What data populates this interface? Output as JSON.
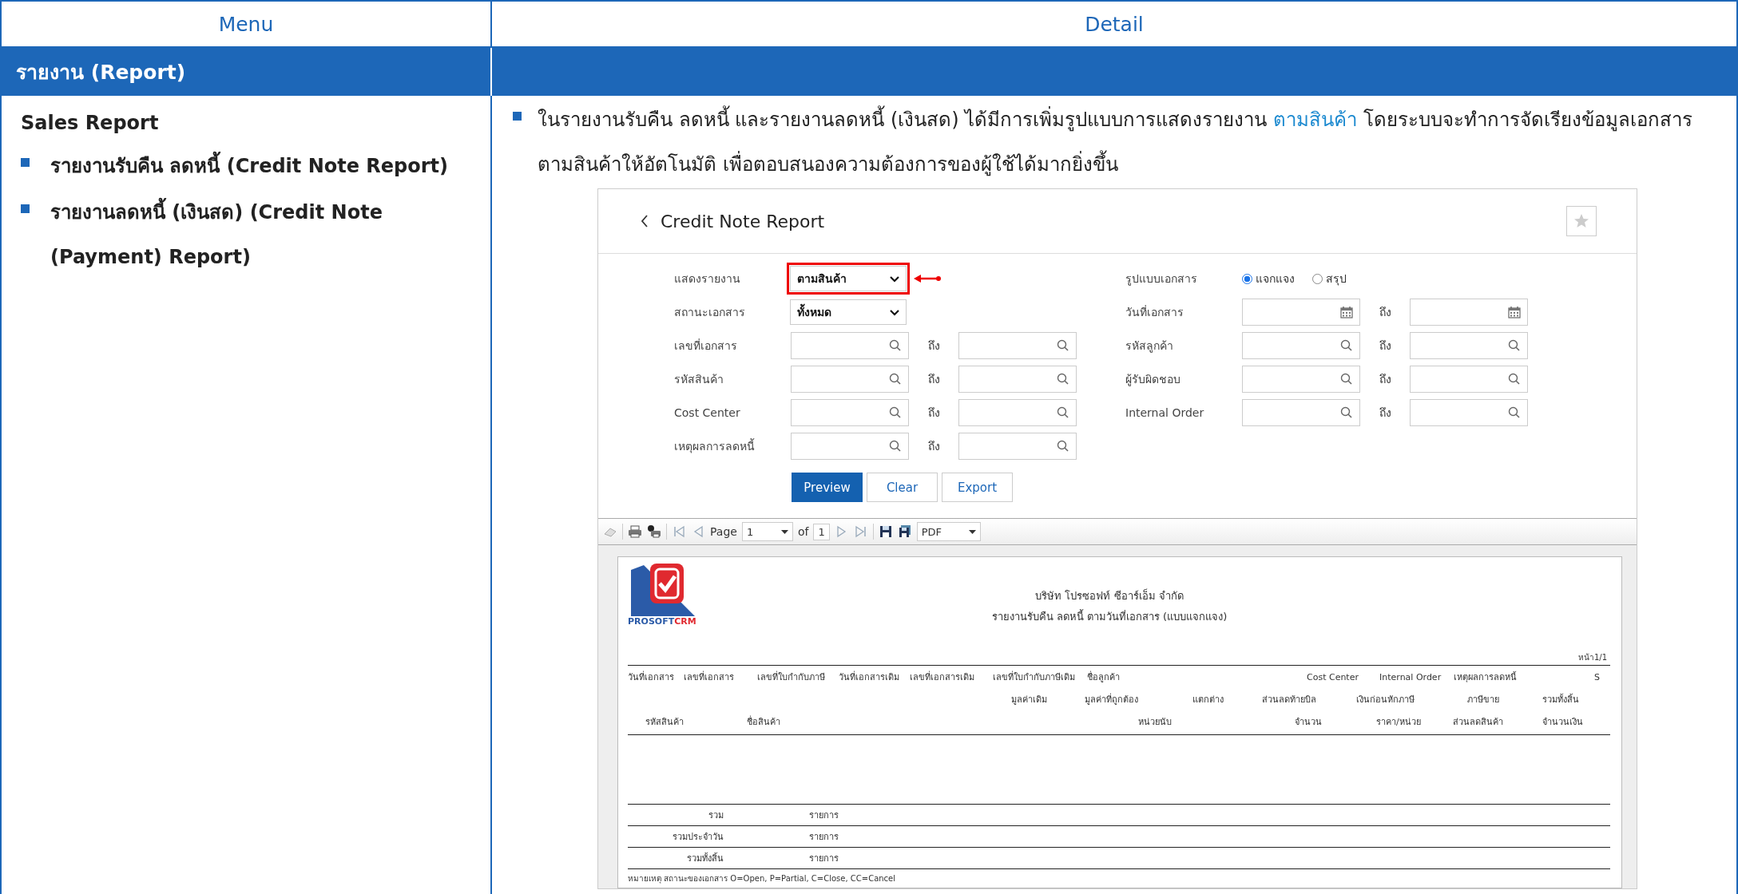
{
  "table": {
    "columns": [
      "Menu",
      "Detail"
    ],
    "section": "รายงาน (Report)"
  },
  "menu": {
    "title": "Sales Report",
    "items": [
      "รายงานรับคืน ลดหนี้ (Credit Note Report)",
      "รายงานลดหนี้ (เงินสด) (Credit Note (Payment) Report)"
    ]
  },
  "detail": {
    "text_before": "ในรายงานรับคืน ลดหนี้ และรายงานลดหนี้ (เงินสด) ได้มีการเพิ่มรูปแบบการแสดงรายงาน ",
    "highlight": "ตามสินค้า",
    "text_after": " โดยระบบจะทำการจัดเรียงข้อมูลเอกสารตามสินค้าให้อัตโนมัติ เพื่อตอบสนองความต้องการของผู้ใช้ได้มากยิ่งขึ้น"
  },
  "screenshot": {
    "title": "Credit Note Report",
    "form_left": [
      {
        "label": "แสดงรายงาน",
        "kind": "select",
        "value": "ตามสินค้า",
        "highlighted": true
      },
      {
        "label": "สถานะเอกสาร",
        "kind": "select",
        "value": "ทั้งหมด",
        "highlighted": false
      },
      {
        "label": "เลขที่เอกสาร",
        "kind": "range",
        "to": "ถึง"
      },
      {
        "label": "รหัสสินค้า",
        "kind": "range",
        "to": "ถึง"
      },
      {
        "label": "Cost Center",
        "kind": "range",
        "to": "ถึง"
      },
      {
        "label": "เหตุผลการลดหนี้",
        "kind": "range",
        "to": "ถึง"
      }
    ],
    "form_right": [
      {
        "label": "รูปแบบเอกสาร",
        "kind": "radio",
        "options": [
          {
            "label": "แจกแจง",
            "selected": true
          },
          {
            "label": "สรุป",
            "selected": false
          }
        ]
      },
      {
        "label": "วันที่เอกสาร",
        "kind": "date_range",
        "to": "ถึง"
      },
      {
        "label": "รหัสลูกค้า",
        "kind": "range",
        "to": "ถึง"
      },
      {
        "label": "ผู้รับผิดชอบ",
        "kind": "range",
        "to": "ถึง"
      },
      {
        "label": "Internal Order",
        "kind": "range",
        "to": "ถึง"
      }
    ],
    "buttons": [
      {
        "label": "Preview",
        "kind": "primary"
      },
      {
        "label": "Clear",
        "kind": "default"
      },
      {
        "label": "Export",
        "kind": "default"
      }
    ],
    "viewer": {
      "page_label": "Page",
      "page": "1",
      "of_label": "of",
      "page_count": "1",
      "format": "PDF"
    },
    "report": {
      "logo_text": "PROSOFT",
      "logo_text_accent": "CRM",
      "company": "บริษัท โปรซอฟท์ ซีอาร์เอ็ม จำกัด",
      "title": "รายงานรับคืน ลดหนี้ ตามวันที่เอกสาร (แบบแจกแจง)",
      "page_no": "หน้า1/1",
      "header_rows": [
        [
          "วันที่เอกสาร",
          "เลขที่เอกสาร",
          "เลขที่ใบกำกับภาษี",
          "วันที่เอกสารเดิม",
          "เลขที่เอกสารเดิม",
          "เลขที่ใบกำกับภาษีเดิม",
          "ชื่อลูกค้า",
          "Cost Center",
          "Internal Order",
          "เหตุผลการลดหนี้",
          "S"
        ],
        [
          "มูลค่าเดิม",
          "มูลค่าที่ถูกต้อง",
          "แตกต่าง",
          "ส่วนลดท้ายบิล",
          "เงินก่อนหักภาษี",
          "ภาษีขาย",
          "รวมทั้งสิ้น"
        ],
        [
          "รหัสสินค้า",
          "ชื่อสินค้า",
          "หน่วยนับ",
          "จำนวน",
          "ราคา/หน่วย",
          "ส่วนลดสินค้า",
          "จำนวนเงิน"
        ]
      ],
      "totals": [
        {
          "label": "รวม",
          "unit": "รายการ"
        },
        {
          "label": "รวมประจำวัน",
          "unit": "รายการ"
        },
        {
          "label": "รวมทั้งสิ้น",
          "unit": "รายการ"
        }
      ],
      "note": "หมายเหตุ สถานะของเอกสาร O=Open, P=Partial, C=Close, CC=Cancel"
    }
  }
}
